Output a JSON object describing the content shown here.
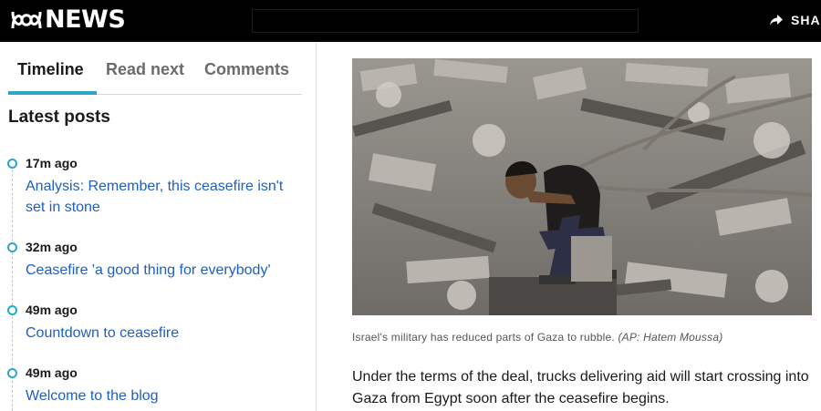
{
  "header": {
    "logo_text": "NEWS",
    "share_label": "SHA"
  },
  "sidebar": {
    "tabs": [
      {
        "label": "Timeline"
      },
      {
        "label": "Read next"
      },
      {
        "label": "Comments"
      }
    ],
    "section_title": "Latest posts",
    "posts": [
      {
        "time": "17m ago",
        "title": "Analysis: Remember, this ceasefire isn't set in stone"
      },
      {
        "time": "32m ago",
        "title": "Ceasefire 'a good thing for everybody'"
      },
      {
        "time": "49m ago",
        "title": "Countdown to ceasefire"
      },
      {
        "time": "49m ago",
        "title": "Welcome to the blog"
      }
    ]
  },
  "article": {
    "image_caption": "Israel's military has reduced parts of Gaza to rubble.",
    "image_credit": "(AP: Hatem Moussa)",
    "paragraph": "Under the terms of the deal, trucks delivering aid will start crossing into Gaza from Egypt soon after the ceasefire begins."
  },
  "colors": {
    "accent": "#2aa8c9",
    "link": "#1f5fbf",
    "topbar": "#000000"
  },
  "icons": [
    "abc-logo-icon",
    "share-arrow-icon"
  ]
}
